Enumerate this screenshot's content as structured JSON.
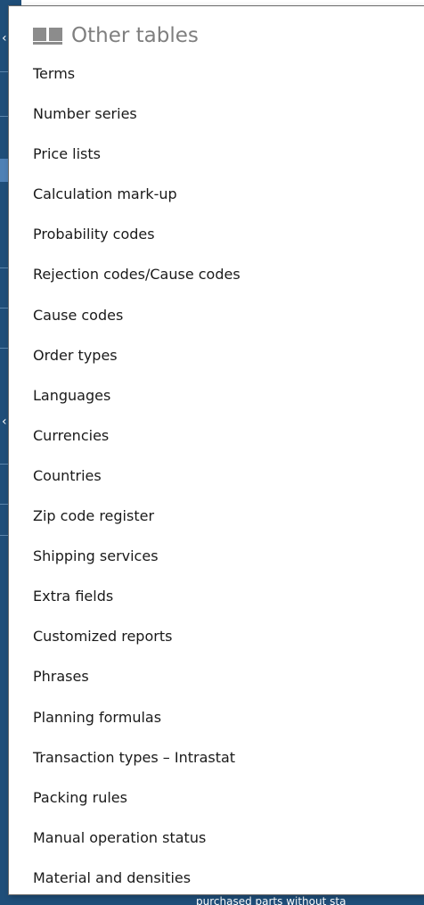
{
  "background": {
    "footer_text": "purchased parts without sta",
    "strip_glyph": "‹"
  },
  "panel": {
    "title": "Other tables",
    "icon": "book-icon",
    "items": [
      {
        "label": "Terms"
      },
      {
        "label": "Number series"
      },
      {
        "label": "Price lists"
      },
      {
        "label": "Calculation mark-up"
      },
      {
        "label": "Probability codes"
      },
      {
        "label": "Rejection codes/Cause codes"
      },
      {
        "label": "Cause codes"
      },
      {
        "label": "Order types"
      },
      {
        "label": "Languages"
      },
      {
        "label": "Currencies"
      },
      {
        "label": "Countries"
      },
      {
        "label": "Zip code register"
      },
      {
        "label": "Shipping services"
      },
      {
        "label": "Extra fields"
      },
      {
        "label": "Customized reports"
      },
      {
        "label": "Phrases"
      },
      {
        "label": "Planning formulas"
      },
      {
        "label": "Transaction types – Intrastat"
      },
      {
        "label": "Packing rules"
      },
      {
        "label": "Manual operation status"
      },
      {
        "label": "Material and densities"
      }
    ]
  },
  "colors": {
    "accent": "#1f4e79",
    "title_gray": "#7f7f7f",
    "item_text": "#1a1a1a"
  }
}
